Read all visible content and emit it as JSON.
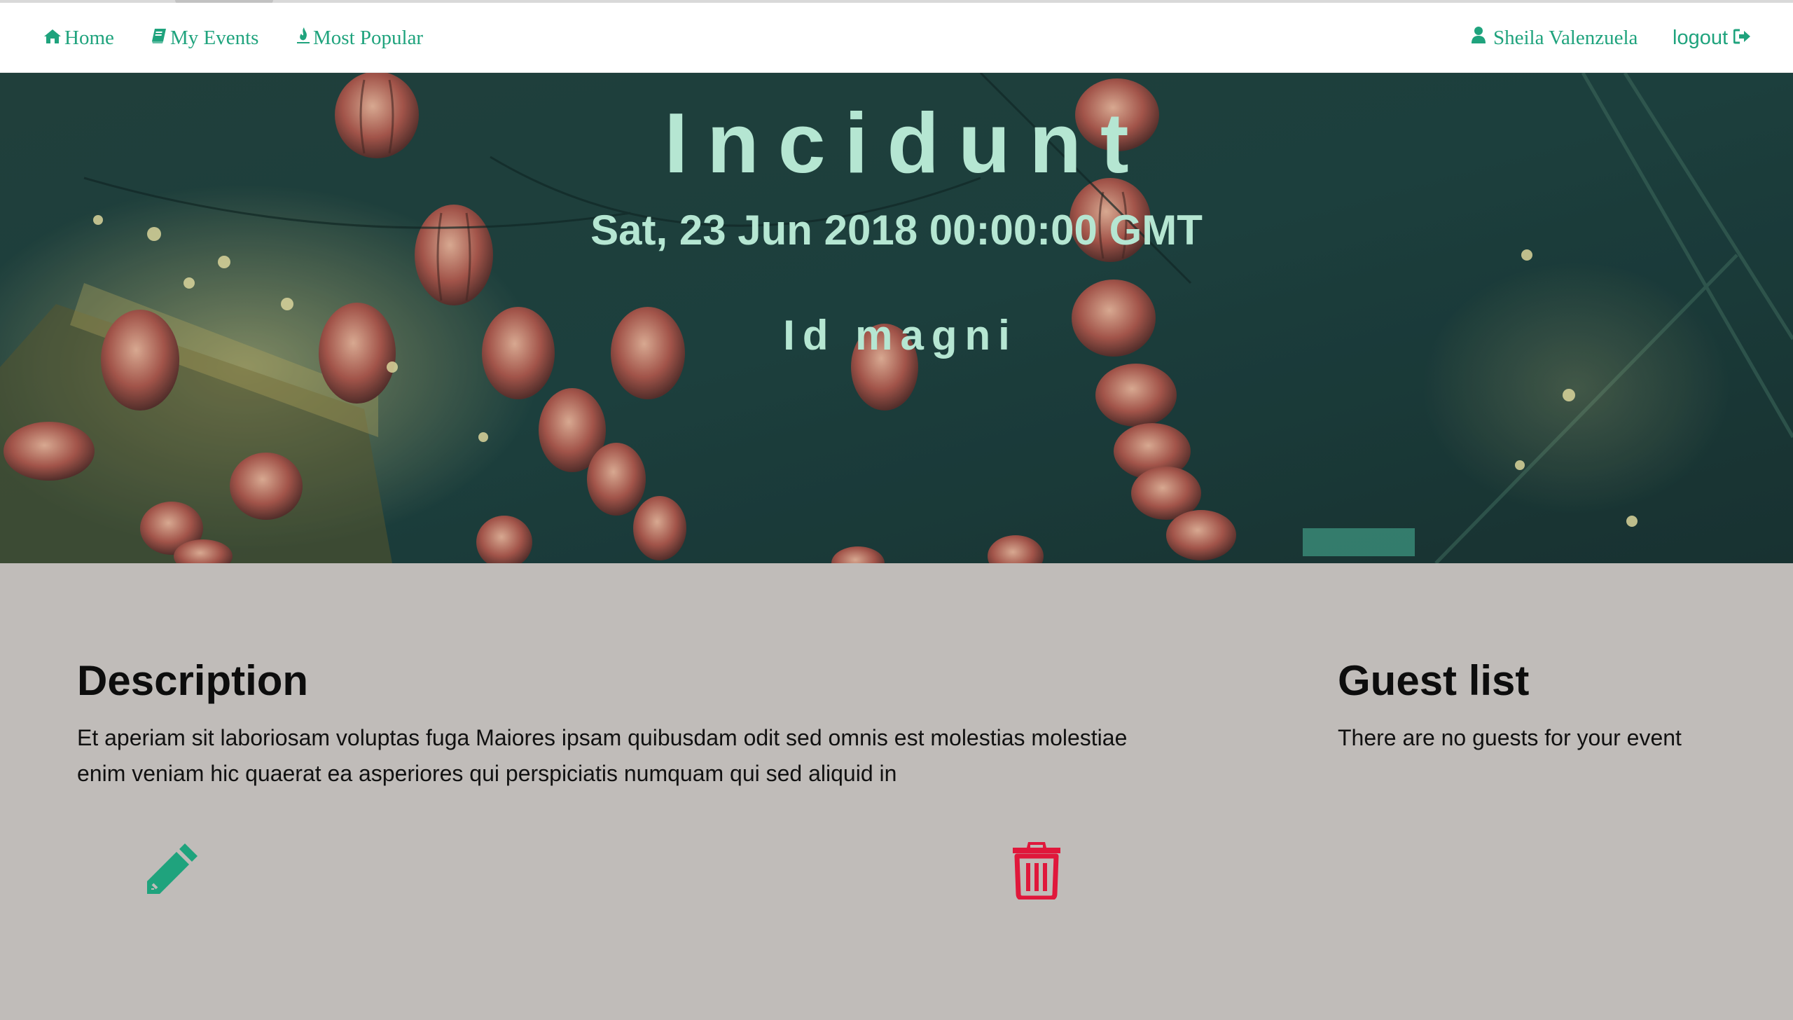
{
  "navbar": {
    "home_label": "Home",
    "my_events_label": "My Events",
    "most_popular_label": "Most Popular",
    "user_name": "Sheila Valenzuela",
    "logout_label": "logout",
    "icons": {
      "home": "home-icon",
      "my_events": "book-icon",
      "most_popular": "fire-icon",
      "user": "user-icon",
      "logout": "sign-out-icon"
    }
  },
  "event": {
    "title": "Incidunt",
    "date": "Sat, 23 Jun 2018 00:00:00 GMT",
    "subtitle": "Id magni"
  },
  "description": {
    "heading": "Description",
    "text": "Et aperiam sit laboriosam voluptas fuga Maiores ipsam quibusdam odit sed omnis est molestias molestiae enim veniam hic quaerat ea asperiores qui perspiciatis numquam qui sed aliquid in"
  },
  "guest_list": {
    "heading": "Guest list",
    "empty_text": "There are no guests for your event"
  },
  "actions": {
    "edit_icon": "pencil-icon",
    "delete_icon": "trash-icon"
  },
  "colors": {
    "accent": "#1fa37d",
    "hero_text": "#b5e6d2",
    "hero_overlay": "#1d403e",
    "content_background": "#c0bcb9",
    "delete": "#e0173b"
  }
}
